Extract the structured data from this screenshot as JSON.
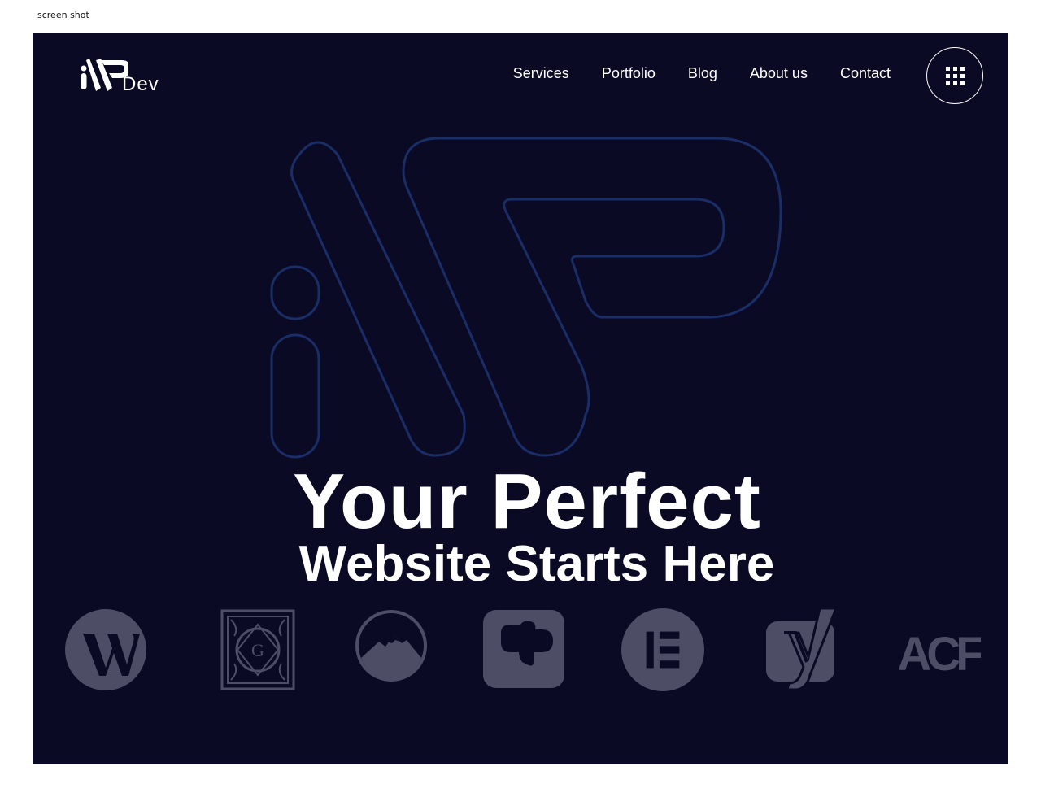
{
  "caption": "screen shot",
  "brand": {
    "logo_text": "Dev"
  },
  "nav": {
    "items": [
      {
        "label": "Services"
      },
      {
        "label": "Portfolio"
      },
      {
        "label": "Blog"
      },
      {
        "label": "About us"
      },
      {
        "label": "Contact"
      }
    ]
  },
  "hero": {
    "line1": "Your Perfect",
    "line2": "Website Starts Here"
  },
  "tech_logos": {
    "items": [
      {
        "icon": "wordpress-icon"
      },
      {
        "icon": "gutenberg-icon"
      },
      {
        "icon": "mountain-icon"
      },
      {
        "icon": "chat-bubble-icon"
      },
      {
        "icon": "elementor-icon"
      },
      {
        "icon": "yoast-icon"
      },
      {
        "icon": "acf-icon",
        "text": "ACF"
      }
    ]
  },
  "colors": {
    "background": "#0a0a24",
    "text": "#ffffff",
    "logo_gray": "#4d4d66",
    "outline_blue": "#1a2d66"
  }
}
